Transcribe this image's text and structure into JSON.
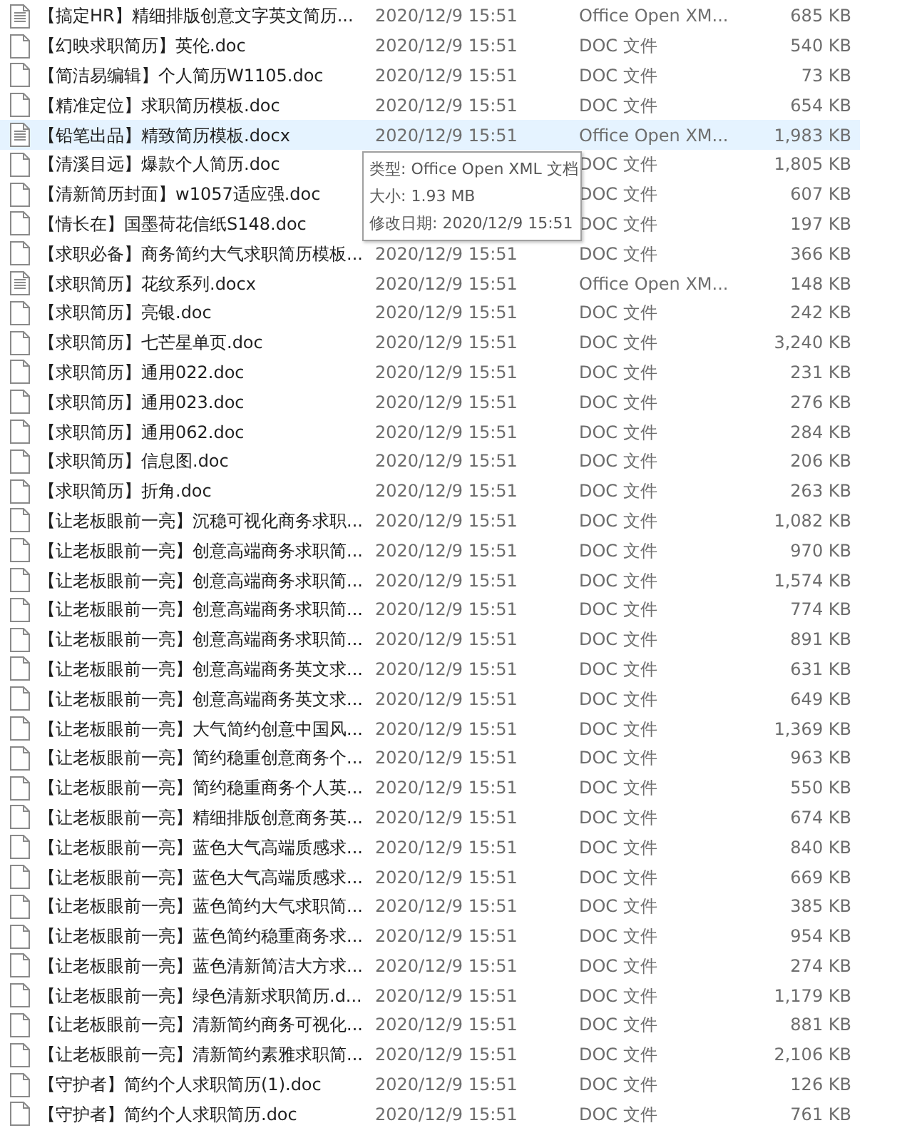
{
  "files": [
    {
      "name": "【搞定HR】精细排版创意文字英文简历...",
      "date": "2020/12/9 15:51",
      "type": "Office Open XM...",
      "size": "685 KB",
      "kind": "lined",
      "selected": false
    },
    {
      "name": "【幻映求职简历】英伦.doc",
      "date": "2020/12/9 15:51",
      "type": "DOC 文件",
      "size": "540 KB",
      "kind": "plain",
      "selected": false
    },
    {
      "name": "【简洁易编辑】个人简历W1105.doc",
      "date": "2020/12/9 15:51",
      "type": "DOC 文件",
      "size": "73 KB",
      "kind": "plain",
      "selected": false
    },
    {
      "name": "【精准定位】求职简历模板.doc",
      "date": "2020/12/9 15:51",
      "type": "DOC 文件",
      "size": "654 KB",
      "kind": "plain",
      "selected": false
    },
    {
      "name": "【铅笔出品】精致简历模板.docx",
      "date": "2020/12/9 15:51",
      "type": "Office Open XM...",
      "size": "1,983 KB",
      "kind": "lined",
      "selected": true
    },
    {
      "name": "【清溪目远】爆款个人简历.doc",
      "type": "DOC 文件",
      "size": "1,805 KB",
      "kind": "plain",
      "selected": false
    },
    {
      "name": "【清新简历封面】w1057适应强.doc",
      "type": "DOC 文件",
      "size": "607 KB",
      "kind": "plain",
      "selected": false
    },
    {
      "name": "【情长在】国墨荷花信纸S148.doc",
      "type": "DOC 文件",
      "size": "197 KB",
      "kind": "plain",
      "selected": false
    },
    {
      "name": "【求职必备】商务简约大气求职简历模板...",
      "date": "2020/12/9 15:51",
      "type": "DOC 文件",
      "size": "366 KB",
      "kind": "plain",
      "selected": false
    },
    {
      "name": "【求职简历】花纹系列.docx",
      "date": "2020/12/9 15:51",
      "type": "Office Open XM...",
      "size": "148 KB",
      "kind": "lined",
      "selected": false
    },
    {
      "name": "【求职简历】亮银.doc",
      "date": "2020/12/9 15:51",
      "type": "DOC 文件",
      "size": "242 KB",
      "kind": "plain",
      "selected": false
    },
    {
      "name": "【求职简历】七芒星单页.doc",
      "date": "2020/12/9 15:51",
      "type": "DOC 文件",
      "size": "3,240 KB",
      "kind": "plain",
      "selected": false
    },
    {
      "name": "【求职简历】通用022.doc",
      "date": "2020/12/9 15:51",
      "type": "DOC 文件",
      "size": "231 KB",
      "kind": "plain",
      "selected": false
    },
    {
      "name": "【求职简历】通用023.doc",
      "date": "2020/12/9 15:51",
      "type": "DOC 文件",
      "size": "276 KB",
      "kind": "plain",
      "selected": false
    },
    {
      "name": "【求职简历】通用062.doc",
      "date": "2020/12/9 15:51",
      "type": "DOC 文件",
      "size": "284 KB",
      "kind": "plain",
      "selected": false
    },
    {
      "name": "【求职简历】信息图.doc",
      "date": "2020/12/9 15:51",
      "type": "DOC 文件",
      "size": "206 KB",
      "kind": "plain",
      "selected": false
    },
    {
      "name": "【求职简历】折角.doc",
      "date": "2020/12/9 15:51",
      "type": "DOC 文件",
      "size": "263 KB",
      "kind": "plain",
      "selected": false
    },
    {
      "name": "【让老板眼前一亮】沉稳可视化商务求职...",
      "date": "2020/12/9 15:51",
      "type": "DOC 文件",
      "size": "1,082 KB",
      "kind": "plain",
      "selected": false
    },
    {
      "name": "【让老板眼前一亮】创意高端商务求职简...",
      "date": "2020/12/9 15:51",
      "type": "DOC 文件",
      "size": "970 KB",
      "kind": "plain",
      "selected": false
    },
    {
      "name": "【让老板眼前一亮】创意高端商务求职简...",
      "date": "2020/12/9 15:51",
      "type": "DOC 文件",
      "size": "1,574 KB",
      "kind": "plain",
      "selected": false
    },
    {
      "name": "【让老板眼前一亮】创意高端商务求职简...",
      "date": "2020/12/9 15:51",
      "type": "DOC 文件",
      "size": "774 KB",
      "kind": "plain",
      "selected": false
    },
    {
      "name": "【让老板眼前一亮】创意高端商务求职简...",
      "date": "2020/12/9 15:51",
      "type": "DOC 文件",
      "size": "891 KB",
      "kind": "plain",
      "selected": false
    },
    {
      "name": "【让老板眼前一亮】创意高端商务英文求...",
      "date": "2020/12/9 15:51",
      "type": "DOC 文件",
      "size": "631 KB",
      "kind": "plain",
      "selected": false
    },
    {
      "name": "【让老板眼前一亮】创意高端商务英文求...",
      "date": "2020/12/9 15:51",
      "type": "DOC 文件",
      "size": "649 KB",
      "kind": "plain",
      "selected": false
    },
    {
      "name": "【让老板眼前一亮】大气简约创意中国风...",
      "date": "2020/12/9 15:51",
      "type": "DOC 文件",
      "size": "1,369 KB",
      "kind": "plain",
      "selected": false
    },
    {
      "name": "【让老板眼前一亮】简约稳重创意商务个...",
      "date": "2020/12/9 15:51",
      "type": "DOC 文件",
      "size": "963 KB",
      "kind": "plain",
      "selected": false
    },
    {
      "name": "【让老板眼前一亮】简约稳重商务个人英...",
      "date": "2020/12/9 15:51",
      "type": "DOC 文件",
      "size": "550 KB",
      "kind": "plain",
      "selected": false
    },
    {
      "name": "【让老板眼前一亮】精细排版创意商务英...",
      "date": "2020/12/9 15:51",
      "type": "DOC 文件",
      "size": "674 KB",
      "kind": "plain",
      "selected": false
    },
    {
      "name": "【让老板眼前一亮】蓝色大气高端质感求...",
      "date": "2020/12/9 15:51",
      "type": "DOC 文件",
      "size": "840 KB",
      "kind": "plain",
      "selected": false
    },
    {
      "name": "【让老板眼前一亮】蓝色大气高端质感求...",
      "date": "2020/12/9 15:51",
      "type": "DOC 文件",
      "size": "669 KB",
      "kind": "plain",
      "selected": false
    },
    {
      "name": "【让老板眼前一亮】蓝色简约大气求职简...",
      "date": "2020/12/9 15:51",
      "type": "DOC 文件",
      "size": "385 KB",
      "kind": "plain",
      "selected": false
    },
    {
      "name": "【让老板眼前一亮】蓝色简约稳重商务求...",
      "date": "2020/12/9 15:51",
      "type": "DOC 文件",
      "size": "954 KB",
      "kind": "plain",
      "selected": false
    },
    {
      "name": "【让老板眼前一亮】蓝色清新简洁大方求...",
      "date": "2020/12/9 15:51",
      "type": "DOC 文件",
      "size": "274 KB",
      "kind": "plain",
      "selected": false
    },
    {
      "name": "【让老板眼前一亮】绿色清新求职简历.d...",
      "date": "2020/12/9 15:51",
      "type": "DOC 文件",
      "size": "1,179 KB",
      "kind": "plain",
      "selected": false
    },
    {
      "name": "【让老板眼前一亮】清新简约商务可视化...",
      "date": "2020/12/9 15:51",
      "type": "DOC 文件",
      "size": "881 KB",
      "kind": "plain",
      "selected": false
    },
    {
      "name": "【让老板眼前一亮】清新简约素雅求职简...",
      "date": "2020/12/9 15:51",
      "type": "DOC 文件",
      "size": "2,106 KB",
      "kind": "plain",
      "selected": false
    },
    {
      "name": "【守护者】简约个人求职简历(1).doc",
      "date": "2020/12/9 15:51",
      "type": "DOC 文件",
      "size": "126 KB",
      "kind": "plain",
      "selected": false
    },
    {
      "name": "【守护者】简约个人求职简历.doc",
      "date": "2020/12/9 15:51",
      "type": "DOC 文件",
      "size": "761 KB",
      "kind": "plain",
      "selected": false
    }
  ],
  "tooltip": {
    "lines": [
      "类型: Office Open XML 文档",
      "大小: 1.93 MB",
      "修改日期: 2020/12/9 15:51"
    ]
  }
}
